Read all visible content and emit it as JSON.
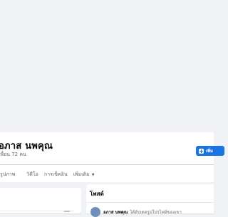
{
  "profile": {
    "name": "อภาส นพคุณ",
    "friend_count": "เพื่อน 72 คน",
    "add_friend_label": "เพิ่ม"
  },
  "tabs": [
    {
      "label": "รูปภาพ"
    },
    {
      "label": "วิดีโอ"
    },
    {
      "label": "การเช็คอิน"
    },
    {
      "label": "เพิ่มเติม"
    }
  ],
  "posts": {
    "title": "โพสต์",
    "first_post": {
      "author": "อภาส นพคุณ",
      "action": "ได้อัปเดตรูปโปรไฟล์ของเขา"
    }
  },
  "colors": {
    "background": "#f0f2f5",
    "accent": "#1b74e4",
    "secondary_text": "#65676b"
  },
  "icons": {
    "add_friend": "plus-icon",
    "more_dropdown": "caret-down-icon"
  }
}
